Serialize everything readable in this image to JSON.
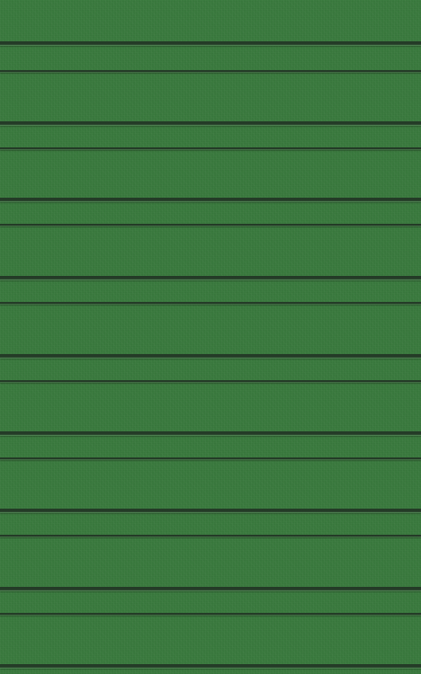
{
  "theme": {
    "felt_color": "#3a7a3e",
    "groove_dark": "#243b27",
    "groove_highlight": "#5c9a5f"
  },
  "icons": []
}
